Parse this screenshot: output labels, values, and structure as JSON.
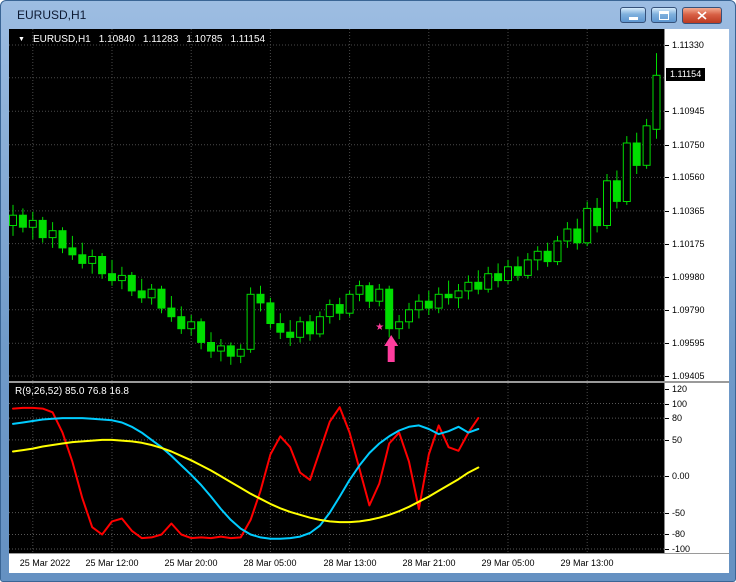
{
  "window": {
    "title": "EURUSD,H1"
  },
  "icons": {
    "dropdown": "▼",
    "signal_star": "★",
    "minimize": "minimize-bar",
    "maximize": "restore-square",
    "close": "x-cross"
  },
  "ohlc_header": {
    "symbol": "EURUSD,H1",
    "open": "1.10840",
    "high": "1.11283",
    "low": "1.10785",
    "close": "1.11154"
  },
  "indicator_header": "R(9,26,52) 85.0 76.8 16.8",
  "colors": {
    "chart_bg": "#000000",
    "grid": "#4a4a4a",
    "level": "#585858",
    "candle": "#00dd00",
    "bull_fill": "#000000",
    "axis_bg": "#ffffff",
    "axis_text": "#000000",
    "current_price_bg": "#000000",
    "current_price_text": "#ffffff",
    "indicator_fast": "#ff0000",
    "indicator_mid": "#00ccff",
    "indicator_slow": "#ffff00",
    "signal": "#ff3d9e"
  },
  "chart_data": {
    "type": "candlestick",
    "title": "EURUSD H1 candlestick chart with R(9,26,52) oscillator subwindow and buy signal arrow",
    "symbol": "EURUSD",
    "timeframe": "H1",
    "price_axis": {
      "range": [
        1.09405,
        1.1133
      ],
      "gridline_prices": [
        1.1133,
        1.1114,
        1.10945,
        1.1075,
        1.1056,
        1.10365,
        1.10175,
        1.0998,
        1.0979,
        1.09595,
        1.09405
      ],
      "labels": [
        {
          "text": "1.11330",
          "value": 1.1133
        },
        {
          "text": "1.10945",
          "value": 1.10945
        },
        {
          "text": "1.10750",
          "value": 1.1075
        },
        {
          "text": "1.10560",
          "value": 1.1056
        },
        {
          "text": "1.10365",
          "value": 1.10365
        },
        {
          "text": "1.10175",
          "value": 1.10175
        },
        {
          "text": "1.09980",
          "value": 1.0998
        },
        {
          "text": "1.09790",
          "value": 1.0979
        },
        {
          "text": "1.09595",
          "value": 1.09595
        },
        {
          "text": "1.09405",
          "value": 1.09405
        }
      ],
      "current": {
        "text": "1.11154",
        "value": 1.11154
      }
    },
    "time_axis": {
      "labels": [
        "25 Mar 2022",
        "25 Mar 12:00",
        "25 Mar 20:00",
        "28 Mar 05:00",
        "28 Mar 13:00",
        "28 Mar 21:00",
        "29 Mar 05:00",
        "29 Mar 13:00"
      ],
      "bar_indices": [
        2,
        10,
        18,
        26,
        34,
        42,
        50,
        58
      ]
    },
    "candles": [
      [
        1.1028,
        1.104,
        1.1022,
        1.1034
      ],
      [
        1.1034,
        1.1038,
        1.1024,
        1.1027
      ],
      [
        1.1027,
        1.1036,
        1.102,
        1.1031
      ],
      [
        1.1031,
        1.1033,
        1.1018,
        1.1021
      ],
      [
        1.1021,
        1.103,
        1.1015,
        1.1025
      ],
      [
        1.1025,
        1.1027,
        1.1012,
        1.1015
      ],
      [
        1.1015,
        1.1022,
        1.1008,
        1.1011
      ],
      [
        1.1011,
        1.1018,
        1.1003,
        1.1006
      ],
      [
        1.1006,
        1.1014,
        1.1,
        1.101
      ],
      [
        1.101,
        1.1012,
        1.0997,
        1.1
      ],
      [
        1.1,
        1.1008,
        1.0993,
        1.0996
      ],
      [
        1.0996,
        1.1004,
        1.0991,
        1.0999
      ],
      [
        1.0999,
        1.1001,
        1.0987,
        1.099
      ],
      [
        1.099,
        1.0997,
        1.0983,
        1.0986
      ],
      [
        1.0986,
        1.0994,
        1.0982,
        1.0991
      ],
      [
        1.0991,
        1.0993,
        1.0977,
        1.098
      ],
      [
        1.098,
        1.0987,
        1.0972,
        1.0975
      ],
      [
        1.0975,
        1.0981,
        1.0965,
        1.0968
      ],
      [
        1.0968,
        1.0976,
        1.0964,
        1.0972
      ],
      [
        1.0972,
        1.0974,
        1.0956,
        1.096
      ],
      [
        1.096,
        1.0966,
        1.0951,
        1.0955
      ],
      [
        1.0955,
        1.0962,
        1.0949,
        1.0958
      ],
      [
        1.0958,
        1.096,
        1.0947,
        1.0952
      ],
      [
        1.0952,
        1.0959,
        1.0948,
        1.0956
      ],
      [
        1.0956,
        1.0992,
        1.0954,
        1.0988
      ],
      [
        1.0988,
        1.0993,
        1.0978,
        1.0983
      ],
      [
        1.0983,
        1.0986,
        1.0968,
        1.0971
      ],
      [
        1.0971,
        1.0977,
        1.0962,
        1.0966
      ],
      [
        1.0966,
        1.0973,
        1.0958,
        1.0963
      ],
      [
        1.0963,
        1.0975,
        1.096,
        1.0972
      ],
      [
        1.0972,
        1.0976,
        1.0961,
        1.0965
      ],
      [
        1.0965,
        1.0978,
        1.0963,
        1.0975
      ],
      [
        1.0975,
        1.0985,
        1.0971,
        1.0982
      ],
      [
        1.0982,
        1.0986,
        1.0973,
        1.0977
      ],
      [
        1.0977,
        1.099,
        1.0975,
        1.0988
      ],
      [
        1.0988,
        1.0996,
        1.0984,
        1.0993
      ],
      [
        1.0993,
        1.0995,
        1.098,
        1.0984
      ],
      [
        1.0984,
        1.0994,
        1.0981,
        1.0991
      ],
      [
        1.0991,
        1.0993,
        1.0963,
        1.0968
      ],
      [
        1.0968,
        1.0976,
        1.0962,
        1.0972
      ],
      [
        1.0972,
        1.0983,
        1.0968,
        1.0979
      ],
      [
        1.0979,
        1.0988,
        1.0974,
        1.0984
      ],
      [
        1.0984,
        1.099,
        1.0976,
        1.098
      ],
      [
        1.098,
        1.0992,
        1.0977,
        1.0988
      ],
      [
        1.0988,
        1.0996,
        1.0982,
        1.0986
      ],
      [
        1.0986,
        1.0994,
        1.098,
        1.099
      ],
      [
        1.099,
        1.0999,
        1.0985,
        1.0995
      ],
      [
        1.0995,
        1.1002,
        1.0988,
        1.0991
      ],
      [
        1.0991,
        1.1004,
        1.0989,
        1.1
      ],
      [
        1.1,
        1.1006,
        1.0992,
        1.0996
      ],
      [
        1.0996,
        1.1008,
        1.0994,
        1.1004
      ],
      [
        1.1004,
        1.101,
        1.0996,
        1.0999
      ],
      [
        1.0999,
        1.1012,
        1.0997,
        1.1008
      ],
      [
        1.1008,
        1.1016,
        1.1002,
        1.1013
      ],
      [
        1.1013,
        1.1018,
        1.1004,
        1.1007
      ],
      [
        1.1007,
        1.1022,
        1.1005,
        1.1019
      ],
      [
        1.1019,
        1.103,
        1.1015,
        1.1026
      ],
      [
        1.1026,
        1.1032,
        1.1014,
        1.1018
      ],
      [
        1.1018,
        1.1042,
        1.1016,
        1.1038
      ],
      [
        1.1038,
        1.1044,
        1.1024,
        1.1028
      ],
      [
        1.1028,
        1.1058,
        1.1026,
        1.1054
      ],
      [
        1.1054,
        1.106,
        1.1038,
        1.1042
      ],
      [
        1.1042,
        1.108,
        1.104,
        1.1076
      ],
      [
        1.1076,
        1.1082,
        1.1058,
        1.1063
      ],
      [
        1.1063,
        1.109,
        1.1061,
        1.1086
      ],
      [
        1.1084,
        1.11283,
        1.10785,
        1.11154
      ]
    ],
    "signal_marker": {
      "bar": 38,
      "price": 1.0969,
      "type": "buy-arrow-with-star"
    },
    "indicator": {
      "label": "R(9,26,52) 85.0 76.8 16.8",
      "range": [
        -100,
        120
      ],
      "levels": [
        100,
        80,
        50,
        0,
        -50,
        -80,
        -100
      ],
      "axis_labels": [
        {
          "text": "120",
          "value": 120
        },
        {
          "text": "100",
          "value": 100
        },
        {
          "text": "80",
          "value": 80
        },
        {
          "text": "50",
          "value": 50
        },
        {
          "text": "0.00",
          "value": 0
        },
        {
          "text": "-50",
          "value": -50
        },
        {
          "text": "-80",
          "value": -80
        },
        {
          "text": "-100",
          "value": -100
        }
      ],
      "series": [
        {
          "name": "fast",
          "color": "#ff0000",
          "values": [
            93,
            94,
            94,
            93,
            88,
            60,
            20,
            -30,
            -70,
            -80,
            -62,
            -58,
            -75,
            -85,
            -84,
            -80,
            -65,
            -80,
            -85,
            -84,
            -85,
            -83,
            -85,
            -84,
            -60,
            -20,
            30,
            55,
            40,
            5,
            -5,
            35,
            75,
            95,
            60,
            10,
            -40,
            -10,
            45,
            60,
            20,
            -45,
            30,
            70,
            40,
            35,
            60,
            80
          ]
        },
        {
          "name": "medium",
          "color": "#00ccff",
          "values": [
            72,
            74,
            76,
            78,
            79,
            80,
            80,
            80,
            79,
            78,
            77,
            74,
            68,
            60,
            50,
            40,
            28,
            15,
            2,
            -12,
            -28,
            -45,
            -60,
            -72,
            -80,
            -84,
            -86,
            -86,
            -85,
            -83,
            -78,
            -68,
            -50,
            -28,
            -5,
            15,
            32,
            45,
            55,
            63,
            68,
            70,
            65,
            58,
            62,
            68,
            60,
            65
          ]
        },
        {
          "name": "slow",
          "color": "#ffff00",
          "values": [
            34,
            36,
            38,
            41,
            43,
            45,
            47,
            48,
            49,
            50,
            50,
            49,
            48,
            46,
            43,
            39,
            34,
            28,
            22,
            15,
            8,
            0,
            -8,
            -16,
            -24,
            -31,
            -38,
            -44,
            -49,
            -53,
            -57,
            -60,
            -62,
            -63,
            -63,
            -62,
            -60,
            -57,
            -53,
            -48,
            -42,
            -35,
            -28,
            -20,
            -12,
            -4,
            5,
            12
          ]
        }
      ]
    }
  }
}
